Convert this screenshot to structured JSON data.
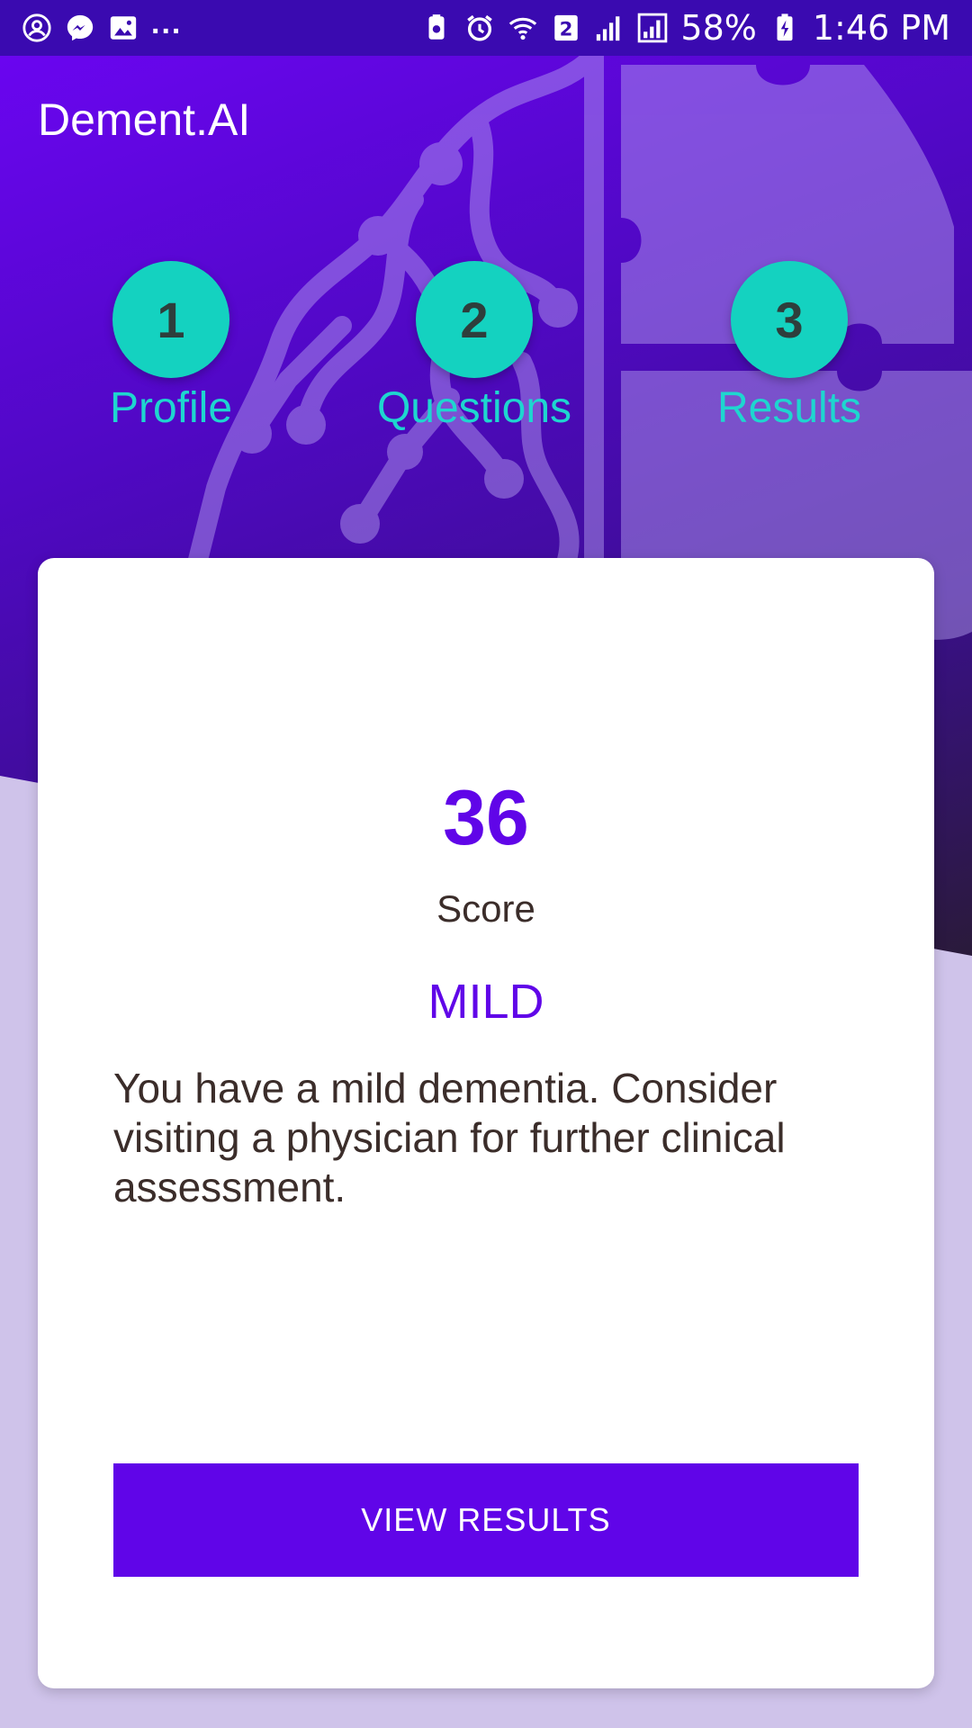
{
  "status_bar": {
    "left_icons": [
      "account-circle-icon",
      "messenger-icon",
      "gallery-icon"
    ],
    "more": "...",
    "right_icons": [
      "app-lock-icon",
      "alarm-icon",
      "wifi-icon",
      "sim-2-icon",
      "signal-icon",
      "signal-box-icon"
    ],
    "sim_badge": "2",
    "battery": "58%",
    "time": "1:46 PM"
  },
  "app": {
    "title": "Dement.AI"
  },
  "stepper": {
    "steps": [
      {
        "number": "1",
        "label": "Profile"
      },
      {
        "number": "2",
        "label": "Questions"
      },
      {
        "number": "3",
        "label": "Results"
      }
    ]
  },
  "result": {
    "score": "36",
    "score_label": "Score",
    "severity": "MILD",
    "message": "You have a mild dementia. Consider visiting a physician for further clinical assessment."
  },
  "actions": {
    "view_results_label": "VIEW RESULTS"
  },
  "colors": {
    "primary": "#6005e8",
    "accent_teal": "#14d2c0",
    "status_bar": "#3a0ab0",
    "background_light": "#cfc3ea"
  }
}
